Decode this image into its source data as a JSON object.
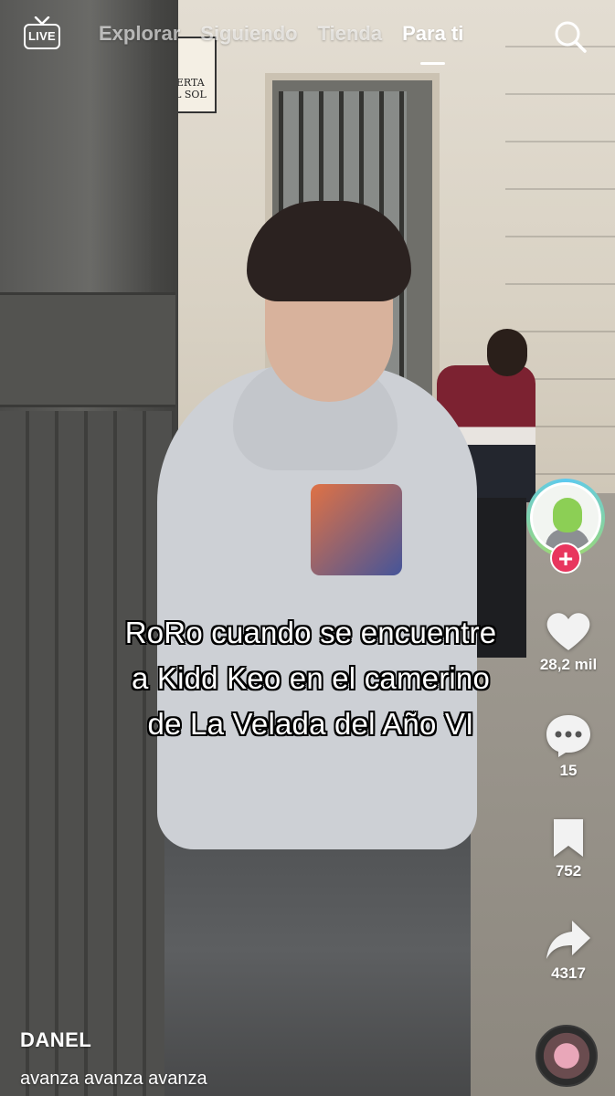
{
  "top_nav": {
    "live_label": "LIVE",
    "tabs": [
      {
        "label": "Explorar",
        "active": false
      },
      {
        "label": "Siguiendo",
        "active": false
      },
      {
        "label": "Tienda",
        "active": false
      },
      {
        "label": "Para ti",
        "active": true
      }
    ],
    "search_icon": "search-icon"
  },
  "scene": {
    "sign_text": "PUERTA DEL SOL"
  },
  "caption": {
    "lines": [
      "RoRo cuando se encuentre",
      "a Kidd Keo en el camerino",
      "de La Velada del Año VI"
    ]
  },
  "rail": {
    "avatar_icon": "creator-avatar",
    "follow_icon": "plus-icon",
    "like": {
      "icon": "heart-icon",
      "count": "28,2 mil"
    },
    "comments": {
      "icon": "comment-icon",
      "count": "15"
    },
    "bookmarks": {
      "icon": "bookmark-icon",
      "count": "752"
    },
    "shares": {
      "icon": "share-icon",
      "count": "4317"
    },
    "follow_color": "#e8365e"
  },
  "post": {
    "author": "DANEL",
    "description": "avanza avanza avanza"
  }
}
